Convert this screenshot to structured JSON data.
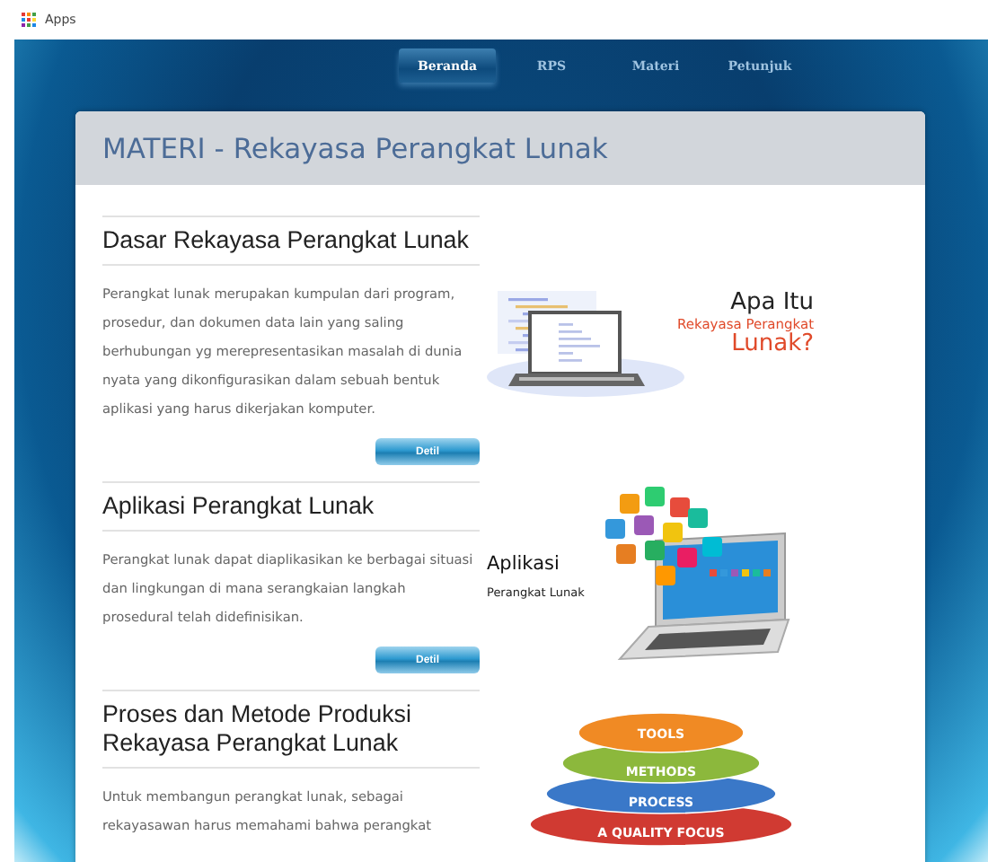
{
  "bookmarks_bar": {
    "label": "Apps"
  },
  "nav": {
    "tabs": [
      {
        "label": "Beranda",
        "selected": true
      },
      {
        "label": "RPS",
        "selected": false
      },
      {
        "label": "Materi",
        "selected": false
      },
      {
        "label": "Petunjuk",
        "selected": false
      }
    ]
  },
  "page": {
    "title": "MATERI - Rekayasa Perangkat Lunak"
  },
  "articles": [
    {
      "title": "Dasar Rekayasa Perangkat Lunak",
      "description": "Perangkat lunak merupakan kumpulan dari program, prosedur, dan dokumen data lain yang saling berhubungan yg merepresentasikan masalah di dunia nyata yang dikonfigurasikan dalam sebuah bentuk aplikasi yang harus dikerjakan komputer.",
      "button": "Detil",
      "image": {
        "kind": "code-laptop",
        "captions": [
          {
            "text": "Apa Itu",
            "kind": "plain"
          },
          {
            "text": "Rekayasa Perangkat",
            "kind": "accent"
          },
          {
            "text": "Lunak?",
            "kind": "accent-large"
          }
        ]
      }
    },
    {
      "title": "Aplikasi Perangkat Lunak",
      "description": "Perangkat lunak dapat diaplikasikan ke berbagai situasi dan lingkungan di mana serangkaian langkah prosedural telah didefinisikan.",
      "button": "Detil",
      "image": {
        "kind": "app-laptop",
        "captions": [
          {
            "text": "Aplikasi",
            "kind": "plain"
          },
          {
            "text": "Perangkat Lunak",
            "kind": "small"
          }
        ]
      }
    },
    {
      "title": "Proses dan Metode Produksi Rekayasa Perangkat Lunak",
      "description": "Untuk membangun perangkat lunak, sebagai rekayasawan harus memahami bahwa perangkat",
      "image": {
        "kind": "layers",
        "layers": [
          {
            "label": "TOOLS",
            "color": "#f08a24"
          },
          {
            "label": "METHODS",
            "color": "#8cb83c"
          },
          {
            "label": "PROCESS",
            "color": "#3a78c8"
          },
          {
            "label": "A QUALITY FOCUS",
            "color": "#d03a32"
          }
        ]
      }
    }
  ]
}
